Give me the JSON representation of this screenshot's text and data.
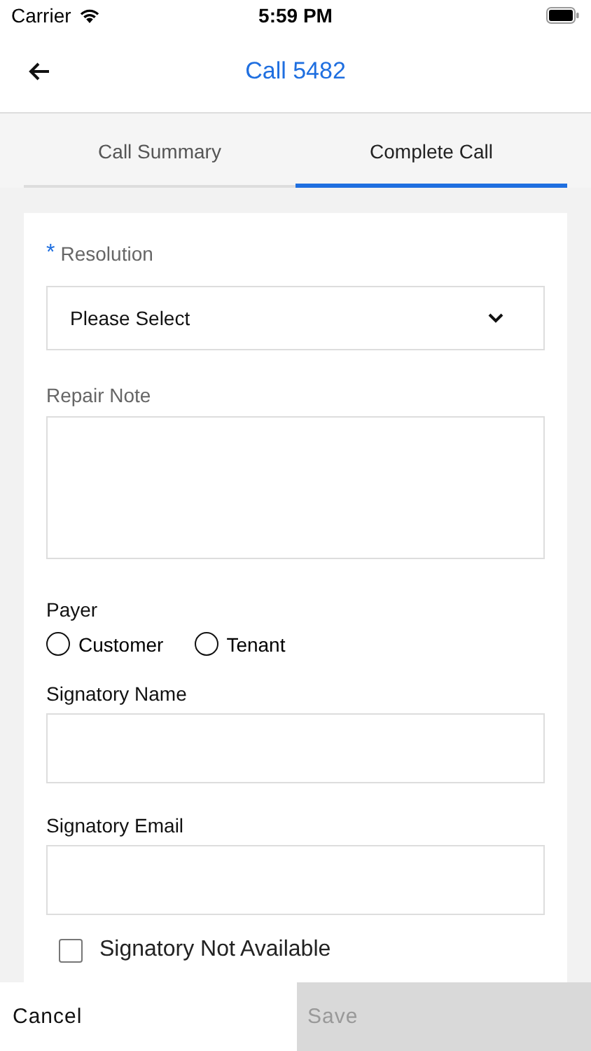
{
  "status_bar": {
    "carrier": "Carrier",
    "time": "5:59 PM"
  },
  "header": {
    "title": "Call 5482"
  },
  "tabs": [
    {
      "label": "Call Summary",
      "selected": false
    },
    {
      "label": "Complete Call",
      "selected": true
    }
  ],
  "form": {
    "resolution": {
      "required_mark": "*",
      "label": "Resolution",
      "value": "Please Select"
    },
    "repair_note": {
      "label": "Repair Note"
    },
    "payer": {
      "label": "Payer",
      "options": [
        {
          "label": "Customer",
          "selected": false
        },
        {
          "label": "Tenant",
          "selected": false
        }
      ]
    },
    "signatory_name": {
      "label": "Signatory Name"
    },
    "signatory_email": {
      "label": "Signatory Email"
    },
    "signatory_not_available": {
      "label": "Signatory Not Available",
      "checked": false
    }
  },
  "footer": {
    "cancel": "Cancel",
    "save": {
      "label": "Save",
      "disabled": true
    }
  }
}
